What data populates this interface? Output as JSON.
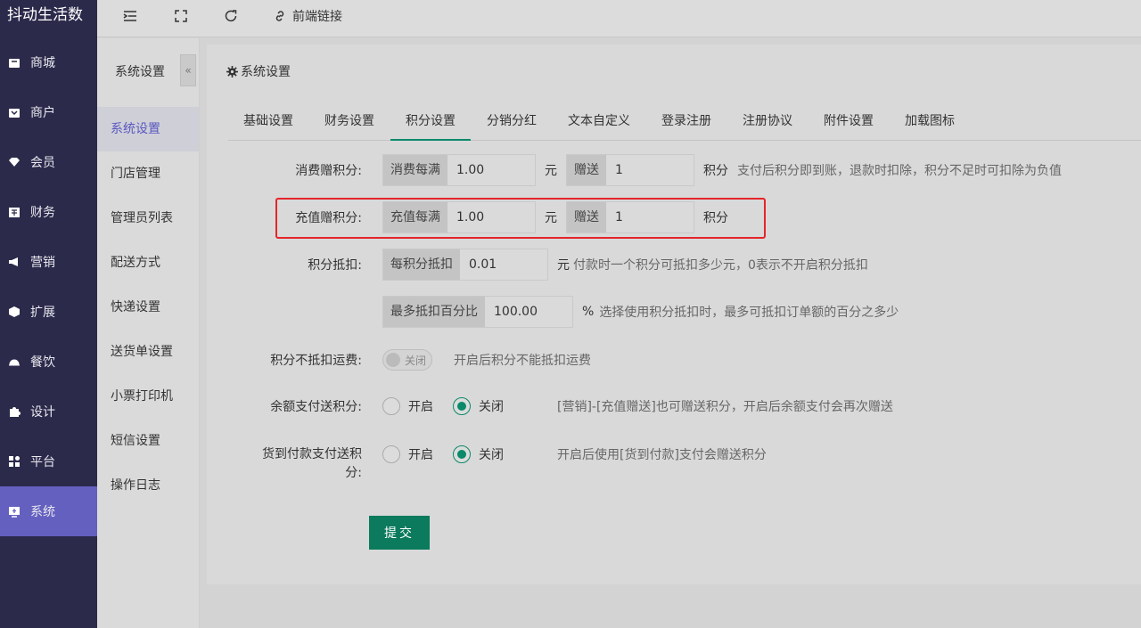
{
  "brand": "抖动生活数",
  "nav": [
    {
      "label": "商城",
      "icon": "store-icon"
    },
    {
      "label": "商户",
      "icon": "merchant-icon"
    },
    {
      "label": "会员",
      "icon": "member-icon"
    },
    {
      "label": "财务",
      "icon": "finance-icon"
    },
    {
      "label": "营销",
      "icon": "megaphone-icon"
    },
    {
      "label": "扩展",
      "icon": "cube-icon"
    },
    {
      "label": "餐饮",
      "icon": "dining-icon"
    },
    {
      "label": "设计",
      "icon": "puzzle-icon"
    },
    {
      "label": "平台",
      "icon": "grid-icon"
    },
    {
      "label": "系统",
      "icon": "system-icon"
    }
  ],
  "topbar": {
    "link_label": "前端链接"
  },
  "submenu": {
    "title": "系统设置",
    "collapse": "«",
    "items": [
      "系统设置",
      "门店管理",
      "管理员列表",
      "配送方式",
      "快递设置",
      "送货单设置",
      "小票打印机",
      "短信设置",
      "操作日志"
    ]
  },
  "panel": {
    "title": "系统设置"
  },
  "tabs": [
    "基础设置",
    "财务设置",
    "积分设置",
    "分销分红",
    "文本自定义",
    "登录注册",
    "注册协议",
    "附件设置",
    "加载图标"
  ],
  "form": {
    "consume": {
      "label": "消费赠积分:",
      "addon1": "消费每满",
      "value1": "1.00",
      "unit1": "元",
      "addon2": "赠送",
      "value2": "1",
      "unit2": "积分",
      "hint": "支付后积分即到账，退款时扣除，积分不足时可扣除为负值"
    },
    "recharge": {
      "label": "充值赠积分:",
      "addon1": "充值每满",
      "value1": "1.00",
      "unit1": "元",
      "addon2": "赠送",
      "value2": "1",
      "unit2": "积分"
    },
    "deduct": {
      "label": "积分抵扣:",
      "addon": "每积分抵扣",
      "value": "0.01",
      "unit": "元",
      "hint": "付款时一个积分可抵扣多少元，0表示不开启积分抵扣"
    },
    "deduct_max": {
      "addon": "最多抵扣百分比",
      "value": "100.00",
      "unit": "%",
      "hint": "选择使用积分抵扣时，最多可抵扣订单额的百分之多少"
    },
    "no_freight": {
      "label": "积分不抵扣运费:",
      "switch_text": "关闭",
      "hint": "开启后积分不能抵扣运费"
    },
    "balance_pay": {
      "label": "余额支付送积分:",
      "on": "开启",
      "off": "关闭",
      "hint": "[营销]-[充值赠送]也可赠送积分，开启后余额支付会再次赠送"
    },
    "cod_pay": {
      "label_line1": "货到付款支付送积",
      "label_line2": "分:",
      "on": "开启",
      "off": "关闭",
      "hint": "开启后使用[货到付款]支付会赠送积分"
    },
    "submit": "提交"
  },
  "colors": {
    "sidebar": "#2b2a4b",
    "active_nav": "#6460c0",
    "primary": "#0b7a5d",
    "highlight": "#e3252a"
  }
}
